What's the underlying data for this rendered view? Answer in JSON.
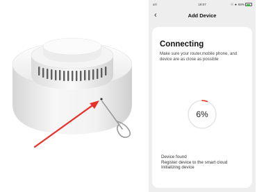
{
  "status_bar": {
    "signal": "all",
    "time": "19:07",
    "right_icons": "☉ ★ 68%",
    "battery_percent": 68
  },
  "nav": {
    "back_icon": "chevron-left-icon",
    "back_glyph": "‹",
    "title": "Add Device"
  },
  "card": {
    "title": "Connecting",
    "description": "Make sure your router,mobile phone, and device are as close as possible",
    "progress_text": "6%",
    "progress": 0.06,
    "steps": [
      "Device found",
      "Register device to the smart cloud",
      "Initializing device"
    ]
  },
  "colors": {
    "accent": "#e8432f",
    "ring_track": "#e6e6e6",
    "arrow": "#e8302a",
    "background": "#eeeeef",
    "card": "#ffffff"
  }
}
